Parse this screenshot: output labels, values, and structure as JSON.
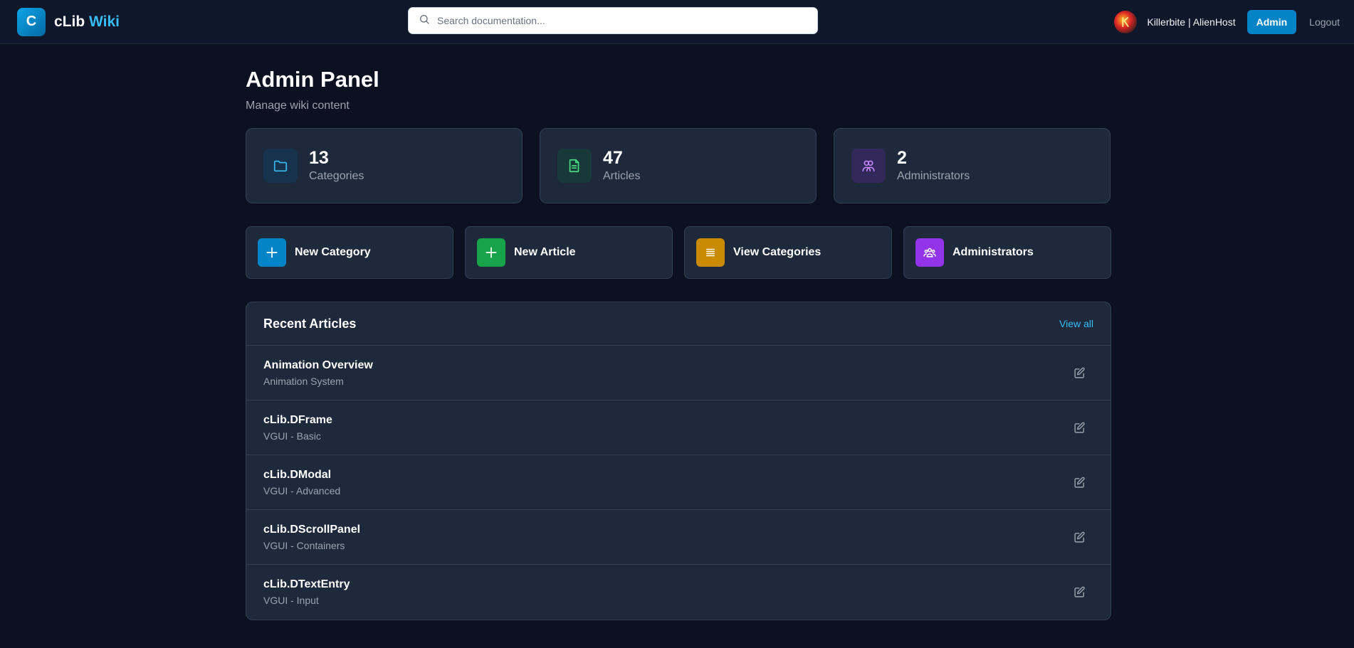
{
  "header": {
    "brand_letter": "C",
    "brand_name": "cLib",
    "brand_accent": "Wiki",
    "search_placeholder": "Search documentation...",
    "avatar_icon": "user-avatar",
    "username": "Killerbite | AlienHost",
    "admin_label": "Admin",
    "logout_label": "Logout"
  },
  "page": {
    "title": "Admin Panel",
    "subtitle": "Manage wiki content"
  },
  "stats": [
    {
      "value": "13",
      "label": "Categories",
      "icon": "folder-icon",
      "color": "#38bdf8"
    },
    {
      "value": "47",
      "label": "Articles",
      "icon": "document-icon",
      "color": "#4ade80"
    },
    {
      "value": "2",
      "label": "Administrators",
      "icon": "users-icon",
      "color": "#c084fc"
    }
  ],
  "actions": [
    {
      "label": "New Category",
      "icon": "plus-icon",
      "color": "#0284c7"
    },
    {
      "label": "New Article",
      "icon": "plus-icon",
      "color": "#16a34a"
    },
    {
      "label": "View Categories",
      "icon": "list-icon",
      "color": "#ca8a04"
    },
    {
      "label": "Administrators",
      "icon": "users-group-icon",
      "color": "#9333ea"
    }
  ],
  "recent": {
    "title": "Recent Articles",
    "view_all": "View all",
    "articles": [
      {
        "title": "Animation Overview",
        "category": "Animation System"
      },
      {
        "title": "cLib.DFrame",
        "category": "VGUI - Basic"
      },
      {
        "title": "cLib.DModal",
        "category": "VGUI - Advanced"
      },
      {
        "title": "cLib.DScrollPanel",
        "category": "VGUI - Containers"
      },
      {
        "title": "cLib.DTextEntry",
        "category": "VGUI - Input"
      }
    ]
  },
  "colors": {
    "background": "#0b1120",
    "card": "#1e293b",
    "accent": "#38bdf8",
    "primary_button": "#0284c7"
  }
}
